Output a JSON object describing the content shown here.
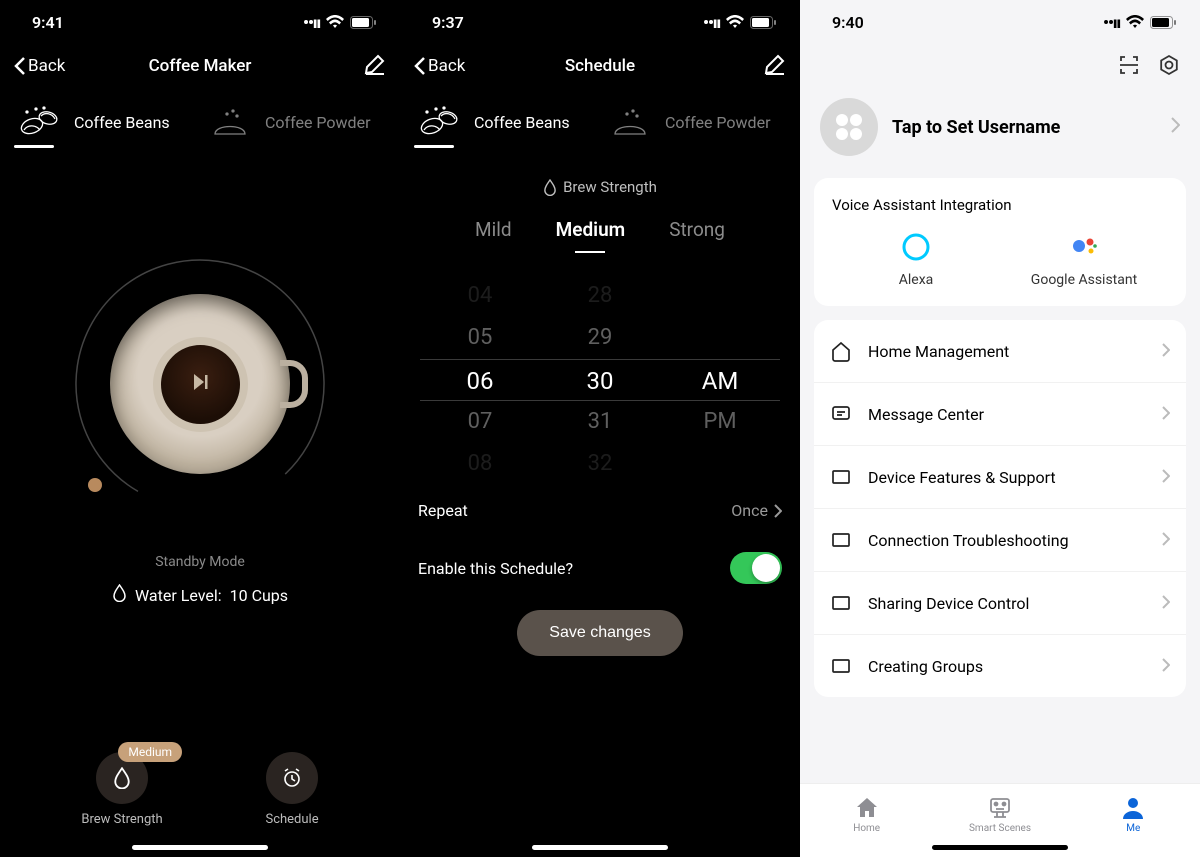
{
  "screen1": {
    "time": "9:41",
    "back": "Back",
    "title": "Coffee Maker",
    "types": {
      "beans": "Coffee Beans",
      "powder": "Coffee Powder"
    },
    "status": "Standby Mode",
    "water_label": "Water Level:",
    "water_value": "10 Cups",
    "strength_badge": "Medium",
    "action_strength": "Brew Strength",
    "action_schedule": "Schedule"
  },
  "screen2": {
    "time": "9:37",
    "back": "Back",
    "title": "Schedule",
    "types": {
      "beans": "Coffee Beans",
      "powder": "Coffee Powder"
    },
    "brew_title": "Brew Strength",
    "tabs": {
      "mild": "Mild",
      "medium": "Medium",
      "strong": "Strong"
    },
    "picker": {
      "rows": [
        {
          "h": "04",
          "m": "28",
          "p": "",
          "far": true
        },
        {
          "h": "05",
          "m": "29",
          "p": ""
        },
        {
          "h": "06",
          "m": "30",
          "p": "AM",
          "sel": true
        },
        {
          "h": "07",
          "m": "31",
          "p": "PM"
        },
        {
          "h": "08",
          "m": "32",
          "p": "",
          "far": true
        }
      ]
    },
    "repeat_label": "Repeat",
    "repeat_value": "Once",
    "enable_label": "Enable this Schedule?",
    "save": "Save changes"
  },
  "screen3": {
    "time": "9:40",
    "username": "Tap to Set Username",
    "voice_title": "Voice Assistant Integration",
    "alexa": "Alexa",
    "google": "Google Assistant",
    "items": [
      "Home Management",
      "Message Center",
      "Device Features & Support",
      "Connection Troubleshooting",
      "Sharing Device Control",
      "Creating Groups"
    ],
    "tabs": {
      "home": "Home",
      "scenes": "Smart Scenes",
      "me": "Me"
    }
  }
}
